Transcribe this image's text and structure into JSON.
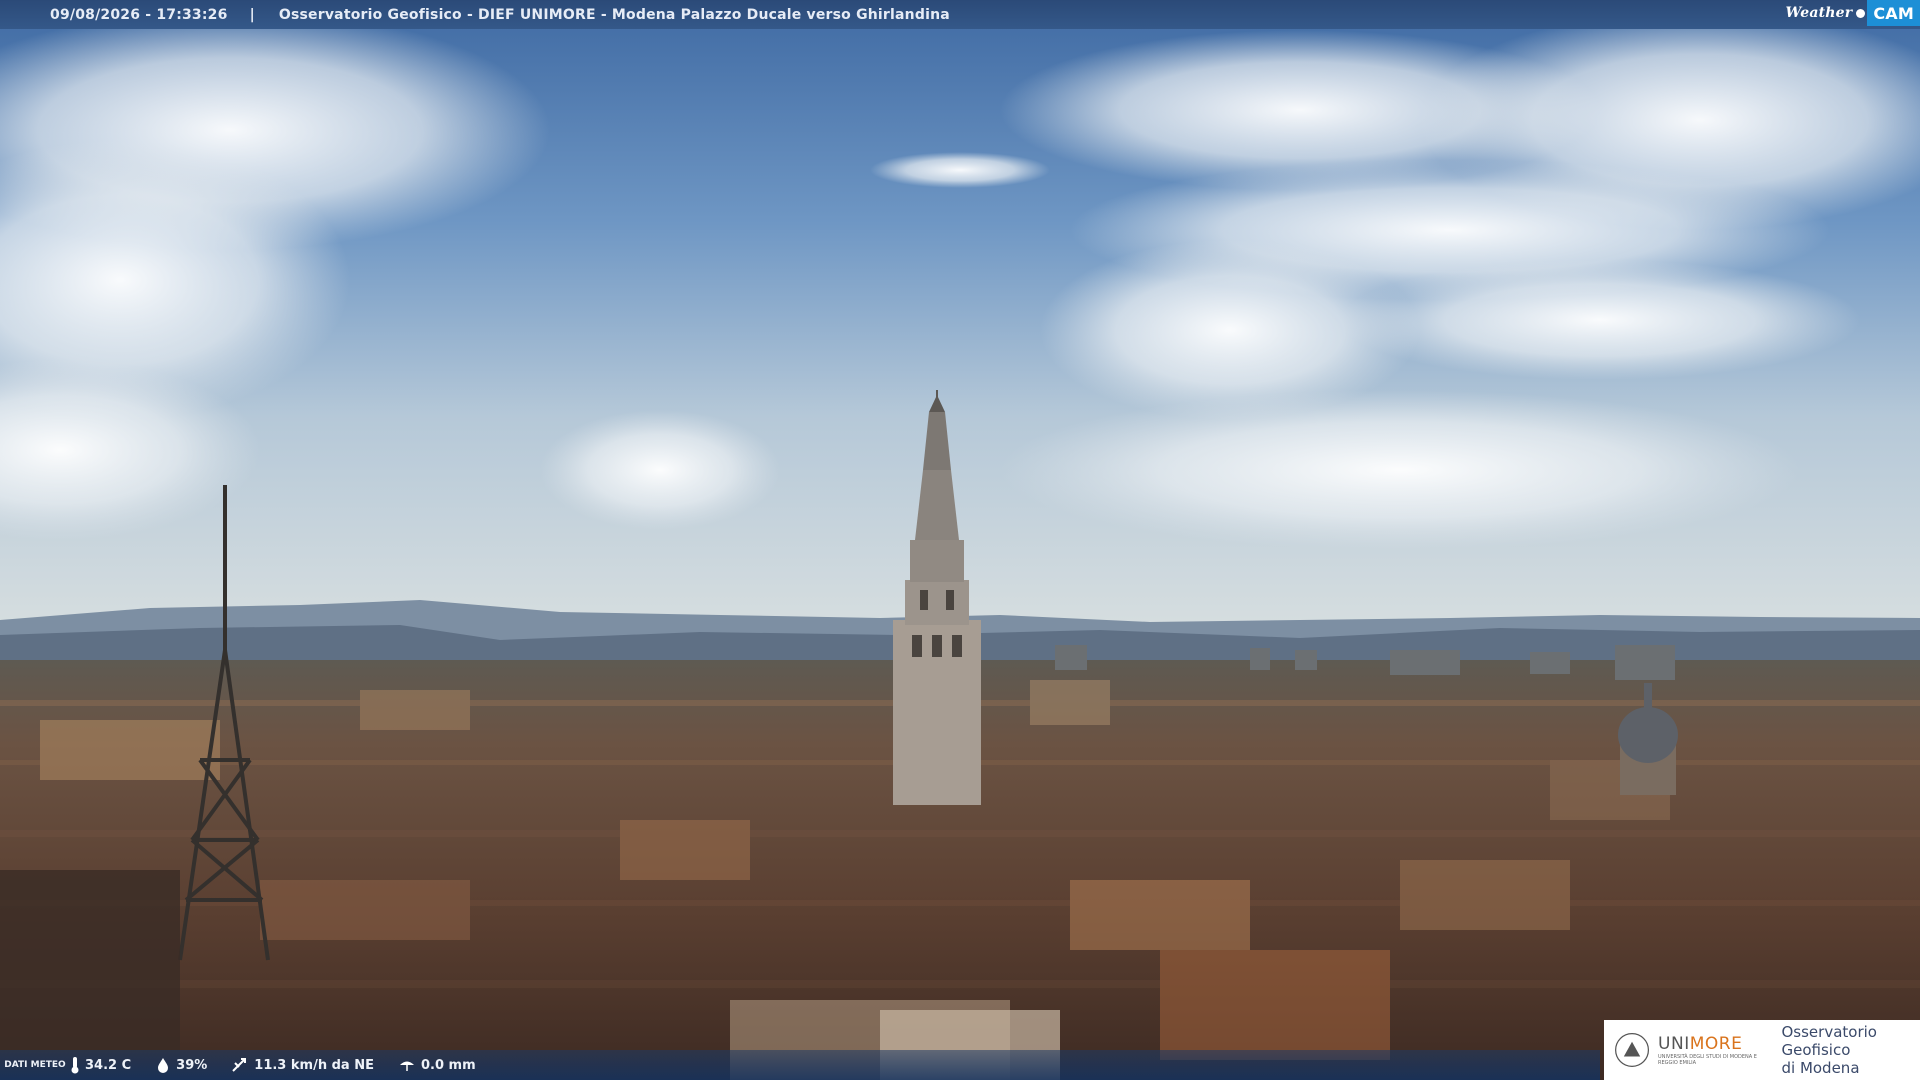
{
  "header": {
    "timestamp": "09/08/2026 - 17:33:26",
    "separator": "|",
    "title": "Osservatorio Geofisico - DIEF UNIMORE - Modena Palazzo Ducale verso Ghirlandina",
    "brand_weather": "Weather",
    "brand_cam": "CAM"
  },
  "weather": {
    "label": "DATI METEO",
    "temperature": "34.2 C",
    "humidity": "39%",
    "wind": "11.3 km/h da NE",
    "rain": "0.0 mm",
    "icons": [
      "thermometer-icon",
      "humidity-drop-icon",
      "wind-icon",
      "rain-icon"
    ]
  },
  "logo": {
    "uni_prefix": "UNI",
    "uni_suffix": "MORE",
    "uni_subtitle": "UNIVERSITÀ DEGLI STUDI DI MODENA E REGGIO EMILIA",
    "observatory_line1": "Osservatorio Geofisico",
    "observatory_line2": "di Modena"
  },
  "colors": {
    "bar": "#2f5285",
    "unimore_orange": "#d9731c",
    "weathercam_blue": "#1d8fd6"
  }
}
